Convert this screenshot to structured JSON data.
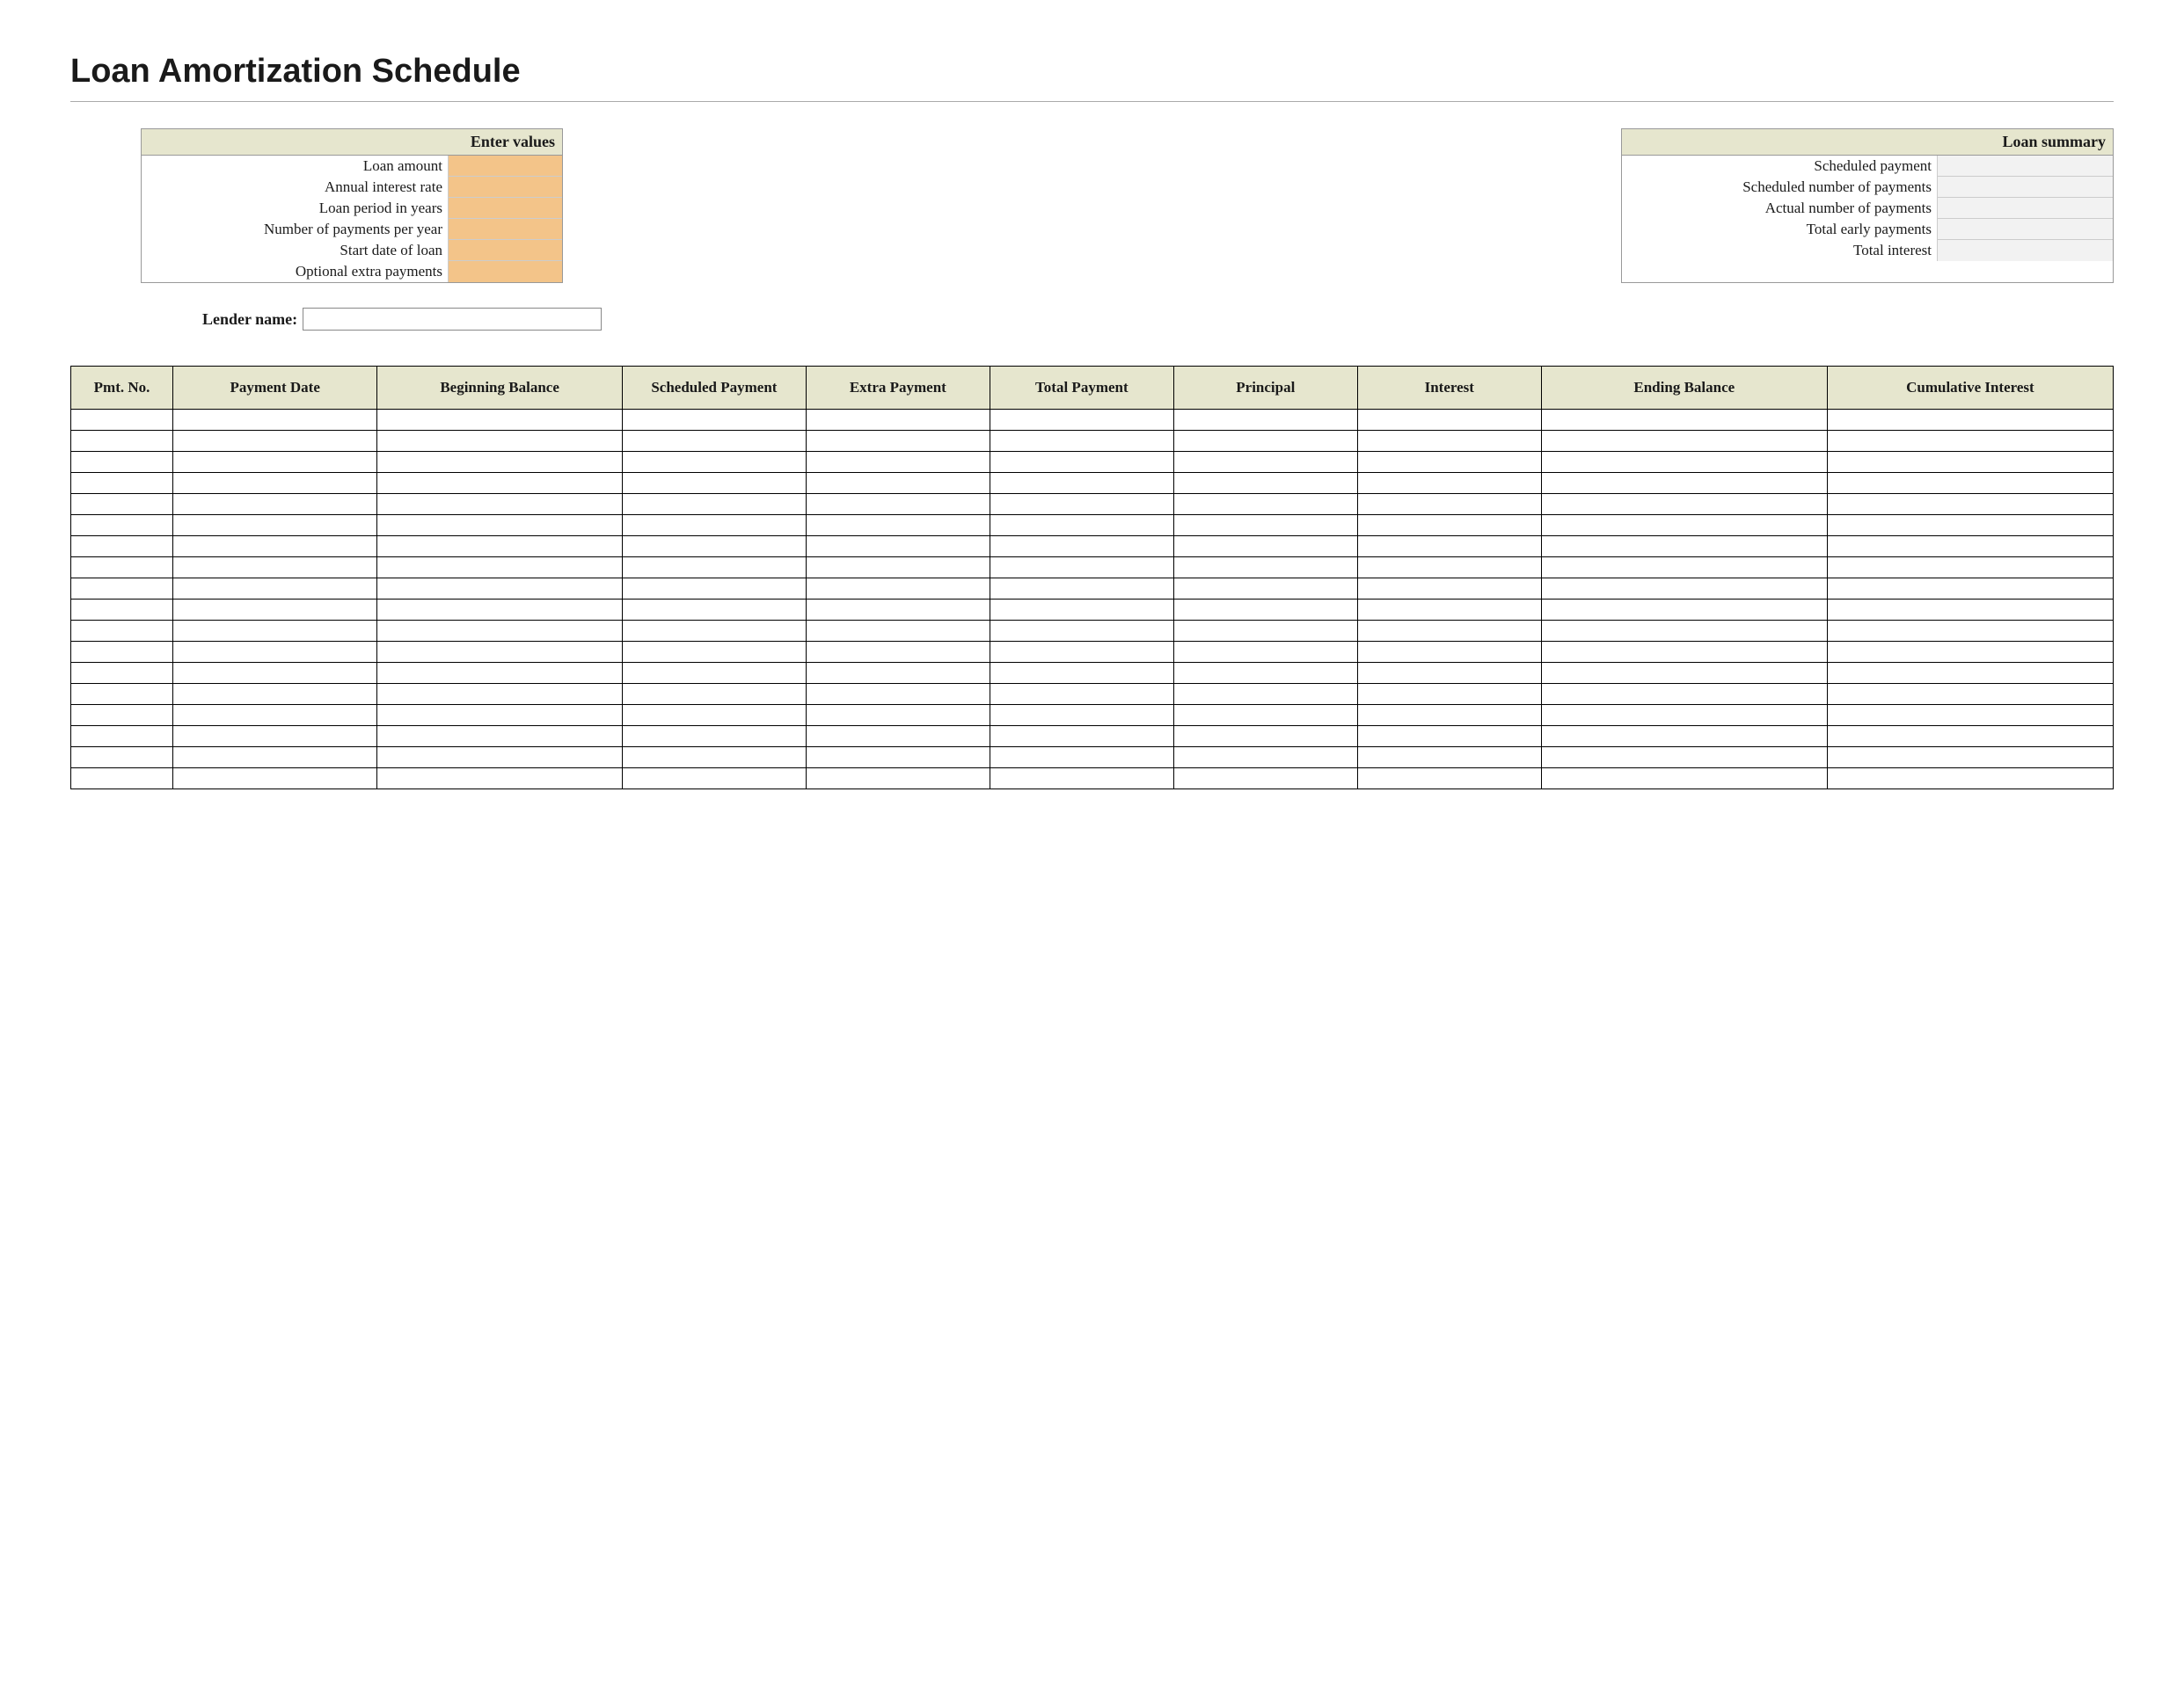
{
  "title": "Loan Amortization Schedule",
  "input_box": {
    "header": "Enter values",
    "rows": [
      {
        "label": "Loan amount",
        "value": ""
      },
      {
        "label": "Annual interest rate",
        "value": ""
      },
      {
        "label": "Loan period in years",
        "value": ""
      },
      {
        "label": "Number of payments per year",
        "value": ""
      },
      {
        "label": "Start date of loan",
        "value": ""
      },
      {
        "label": "Optional extra payments",
        "value": ""
      }
    ]
  },
  "summary_box": {
    "header": "Loan summary",
    "rows": [
      {
        "label": "Scheduled payment",
        "value": ""
      },
      {
        "label": "Scheduled number of payments",
        "value": ""
      },
      {
        "label": "Actual number of payments",
        "value": ""
      },
      {
        "label": "Total early payments",
        "value": ""
      },
      {
        "label": "Total interest",
        "value": ""
      }
    ]
  },
  "lender": {
    "label": "Lender name:",
    "value": ""
  },
  "schedule": {
    "headers": [
      "Pmt. No.",
      "Payment Date",
      "Beginning Balance",
      "Scheduled Payment",
      "Extra Payment",
      "Total Payment",
      "Principal",
      "Interest",
      "Ending Balance",
      "Cumulative Interest"
    ],
    "row_count": 18
  }
}
